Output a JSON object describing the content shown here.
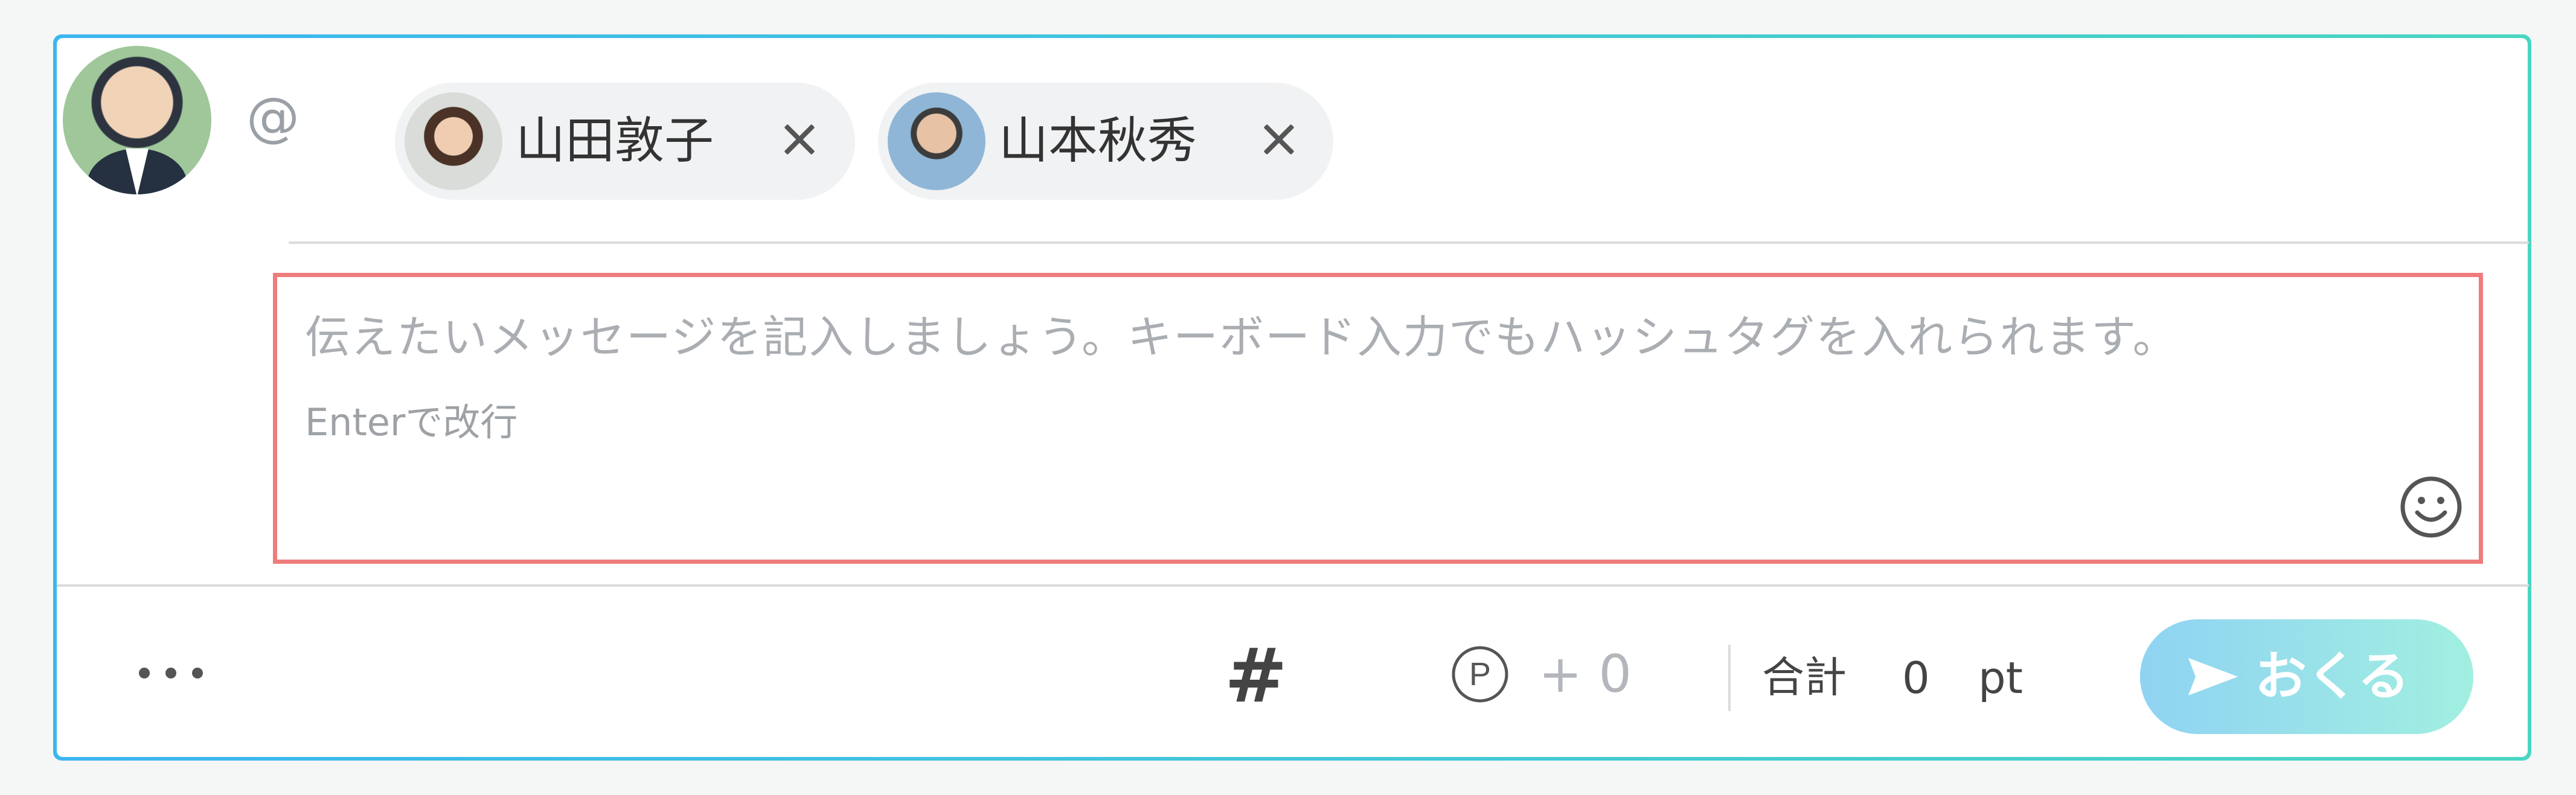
{
  "composer": {
    "mention_symbol": "@",
    "recipients": [
      {
        "name": "山田敦子",
        "close_icon": "close-icon"
      },
      {
        "name": "山本秋秀",
        "close_icon": "close-icon"
      }
    ],
    "message": {
      "placeholder": "伝えたいメッセージを記入しましょう。キーボード入力でもハッシュタグを入れられます。",
      "hint": "Enterで改行",
      "emoji_icon": "smiley-icon"
    },
    "toolbar": {
      "more_icon": "more-icon",
      "hashtag_label": "#",
      "points_symbol": "P",
      "points_add": "+ 0",
      "total_label": "合計",
      "total_value": "0",
      "total_unit": "pt",
      "send_label": "おくる"
    }
  },
  "colors": {
    "accent_start": "#3bb6f0",
    "accent_end": "#49d6c2",
    "message_box_border": "#ef7c7c",
    "send_button_start": "#8fd3f3",
    "send_button_end": "#a1efe0"
  }
}
